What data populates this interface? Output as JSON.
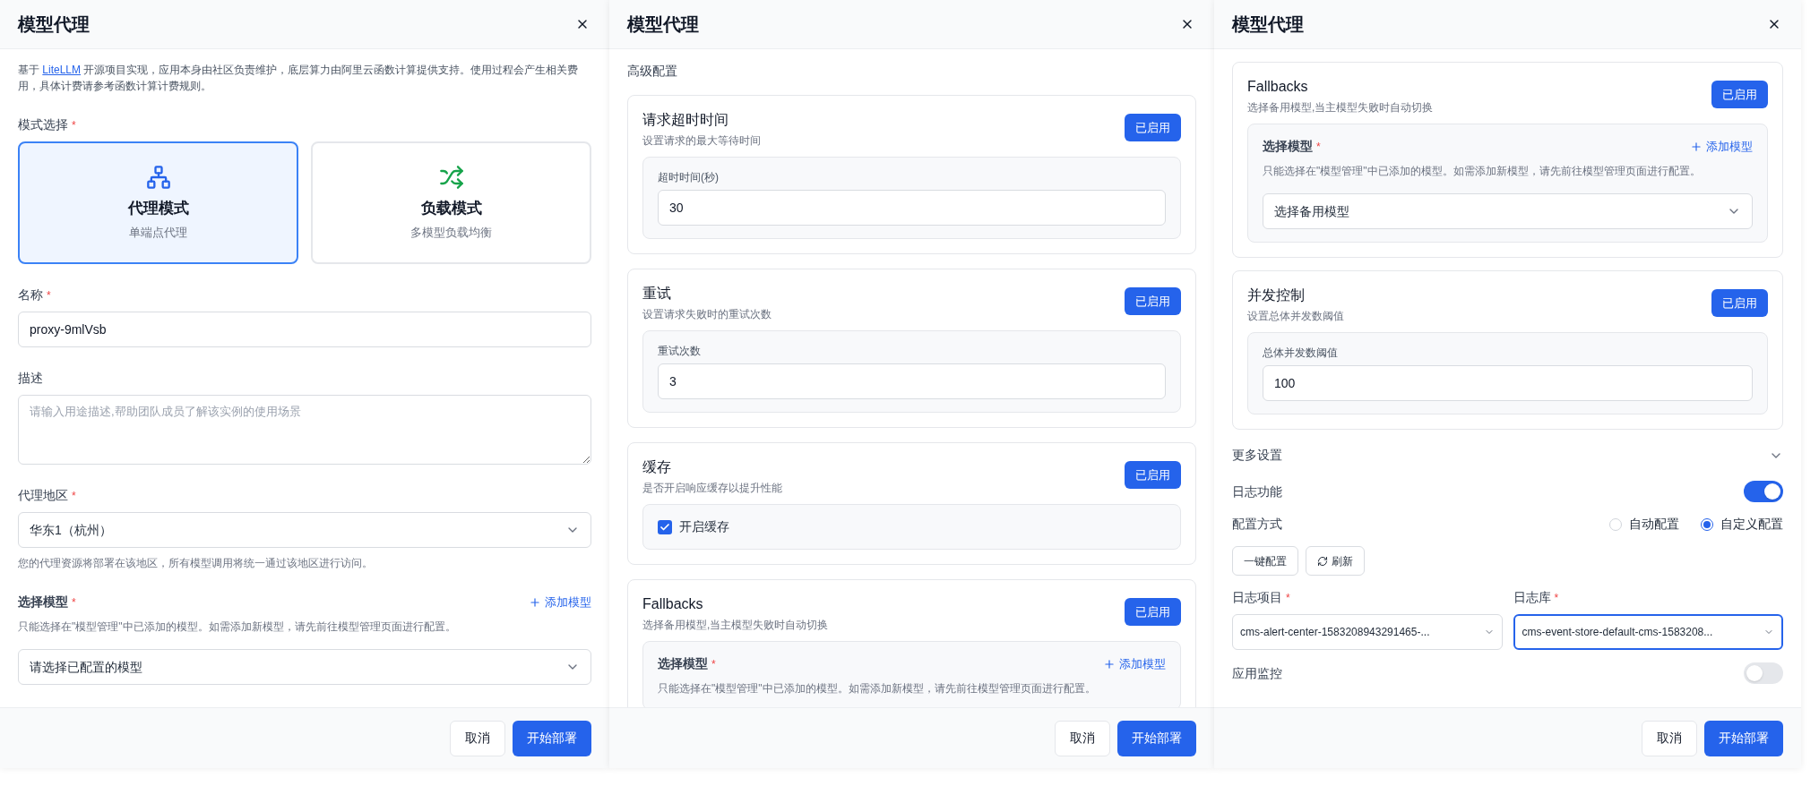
{
  "panels": [
    {
      "title": "模型代理",
      "blocks": [
        {
          "kind": "intro",
          "before": "基于 ",
          "link": "LiteLLM",
          "after": " 开源项目实现，应用本身由社区负责维护，底层算力由阿里云函数计算提供支持。使用过程会产生相关费用，具体计费请参考函数计算计费规则。"
        },
        {
          "kind": "mode_select",
          "label": "模式选择",
          "mark": "*",
          "options": [
            {
              "kind": "proxy",
              "title": "代理模式",
              "subtitle": "单端点代理",
              "selected": true
            },
            {
              "kind": "balance",
              "title": "负载模式",
              "subtitle": "多模型负载均衡",
              "selected": false
            }
          ]
        },
        {
          "kind": "input",
          "label": "名称",
          "mark": "*",
          "value": "proxy-9mlVsb"
        },
        {
          "kind": "textarea",
          "label": "描述",
          "placeholder": "请输入用途描述,帮助团队成员了解该实例的使用场景"
        },
        {
          "kind": "select",
          "label": "代理地区",
          "mark": "*",
          "value": "华东1（杭州）",
          "help": "您的代理资源将部署在该地区，所有模型调用将统一通过该地区进行访问。"
        },
        {
          "kind": "model_picker",
          "label": "选择模型",
          "mark": "*",
          "add_link": "添加模型",
          "help": "只能选择在\"模型管理\"中已添加的模型。如需添加新模型，请先前往模型管理页面进行配置。",
          "value": "请选择已配置的模型"
        }
      ],
      "footer": [
        {
          "kind": "secondary",
          "label": "取消"
        },
        {
          "kind": "primary",
          "label": "开始部署"
        }
      ]
    },
    {
      "title": "模型代理",
      "blocks": [
        {
          "kind": "heading",
          "text": "高级配置"
        },
        {
          "kind": "feature",
          "title": "请求超时时间",
          "subtitle": "设置请求的最大等待时间",
          "button": "已启用",
          "body": {
            "kind": "field",
            "label": "超时时间(秒)",
            "value": "30"
          }
        },
        {
          "kind": "feature",
          "title": "重试",
          "subtitle": "设置请求失败时的重试次数",
          "button": "已启用",
          "body": {
            "kind": "field",
            "label": "重试次数",
            "value": "3"
          }
        },
        {
          "kind": "feature",
          "title": "缓存",
          "subtitle": "是否开启响应缓存以提升性能",
          "button": "已启用",
          "body": {
            "kind": "checkbox",
            "label": "开启缓存",
            "checked": true
          }
        },
        {
          "kind": "feature",
          "title": "Fallbacks",
          "subtitle": "选择备用模型,当主模型失败时自动切换",
          "button": "已启用",
          "body": {
            "kind": "model_picker",
            "label": "选择模型",
            "mark": "*",
            "add_link": "添加模型",
            "help": "只能选择在\"模型管理\"中已添加的模型。如需添加新模型，请先前往模型管理页面进行配置。"
          }
        }
      ],
      "footer": [
        {
          "kind": "secondary",
          "label": "取消"
        },
        {
          "kind": "primary",
          "label": "开始部署"
        }
      ]
    },
    {
      "title": "模型代理",
      "blocks": [
        {
          "kind": "feature",
          "title": "Fallbacks",
          "subtitle": "选择备用模型,当主模型失败时自动切换",
          "button": "已启用",
          "body": {
            "kind": "model_picker",
            "label": "选择模型",
            "mark": "*",
            "add_link": "添加模型",
            "help": "只能选择在\"模型管理\"中已添加的模型。如需添加新模型，请先前往模型管理页面进行配置。",
            "value": "选择备用模型"
          }
        },
        {
          "kind": "feature",
          "title": "并发控制",
          "subtitle": "设置总体并发数阈值",
          "button": "已启用",
          "body": {
            "kind": "field",
            "label": "总体并发数阈值",
            "value": "100"
          }
        },
        {
          "kind": "collapse",
          "label": "更多设置"
        },
        {
          "kind": "switch",
          "label": "日志功能",
          "on": true
        },
        {
          "kind": "radio_group",
          "label": "配置方式",
          "options": [
            {
              "label": "自动配置",
              "selected": false
            },
            {
              "label": "自定义配置",
              "selected": true
            }
          ]
        },
        {
          "kind": "buttons",
          "items": [
            {
              "kind": "plain",
              "label": "一键配置"
            },
            {
              "kind": "refresh",
              "label": "刷新"
            }
          ]
        },
        {
          "kind": "select_pair",
          "items": [
            {
              "label": "日志项目",
              "mark": "*",
              "value": "cms-alert-center-1583208943291465-...",
              "focused": false
            },
            {
              "label": "日志库",
              "mark": "*",
              "value": "cms-event-store-default-cms-1583208...",
              "focused": true
            }
          ]
        },
        {
          "kind": "switch",
          "label": "应用监控",
          "on": false
        }
      ],
      "footer": [
        {
          "kind": "secondary",
          "label": "取消"
        },
        {
          "kind": "primary",
          "label": "开始部署"
        }
      ]
    }
  ]
}
